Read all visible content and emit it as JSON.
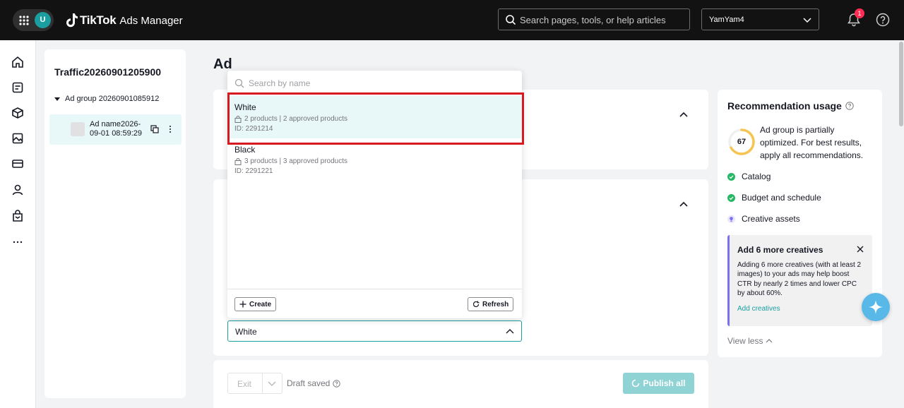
{
  "topbar": {
    "avatar_letter": "U",
    "logo_brand": "TikTok",
    "logo_sub": "Ads Manager",
    "search_placeholder": "Search pages, tools, or help articles",
    "account_name": "YamYam4",
    "notification_count": "1"
  },
  "rail": {
    "icons": [
      "home-icon",
      "campaign-icon",
      "assets-icon",
      "creative-icon",
      "billing-icon",
      "account-icon",
      "shop-icon",
      "more-icon"
    ]
  },
  "tree": {
    "campaign_name": "Traffic20260901205900",
    "ad_group_name": "Ad group 20260901085912",
    "ad_name": "Ad name2026-09-01 08:59:29"
  },
  "main": {
    "page_title": "Ad"
  },
  "dropdown": {
    "search_placeholder": "Search by name",
    "options": [
      {
        "name": "White",
        "meta": "2 products | 2 approved products",
        "id": "ID: 2291214"
      },
      {
        "name": "Black",
        "meta": "3 products | 3 approved products",
        "id": "ID: 2291221"
      }
    ],
    "create_label": "Create",
    "refresh_label": "Refresh",
    "selected_value": "White"
  },
  "actionbar": {
    "exit_label": "Exit",
    "draft_label": "Draft saved",
    "publish_label": "Publish all"
  },
  "recommendation": {
    "title": "Recommendation usage",
    "score": "67",
    "description": "Ad group is partially optimized. For best results, apply all recommendations.",
    "items": [
      {
        "label": "Catalog",
        "status": "done"
      },
      {
        "label": "Budget and schedule",
        "status": "done"
      },
      {
        "label": "Creative assets",
        "status": "tip"
      }
    ],
    "tip_title": "Add 6 more creatives",
    "tip_body": "Adding 6 more creatives (with at least 2 images) to your ads may help boost CTR by nearly 2 times and lower CPC by about 60%.",
    "tip_link": "Add creatives",
    "view_less": "View less"
  },
  "colors": {
    "accent": "#1a9ea0",
    "highlight_border": "#d71920",
    "topbar_bg": "#121212",
    "notification_red": "#fe2c55"
  }
}
